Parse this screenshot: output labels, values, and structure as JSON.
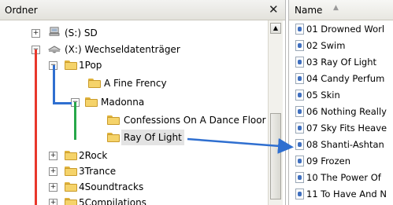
{
  "left_pane": {
    "title": "Ordner",
    "close_glyph": "✕"
  },
  "tree": {
    "items": [
      {
        "label": "(S:) SD",
        "icon": "network-drive-icon",
        "expander": "+"
      },
      {
        "label": "(X:) Wechseldatenträger",
        "icon": "removable-drive-icon",
        "expander": "−"
      },
      {
        "label": "1Pop",
        "icon": "folder-icon",
        "expander": "−"
      },
      {
        "label": "A Fine Frency",
        "icon": "folder-icon"
      },
      {
        "label": "Madonna",
        "icon": "folder-icon",
        "expander": "−"
      },
      {
        "label": "Confessions On A Dance Floor",
        "icon": "folder-icon"
      },
      {
        "label": "Ray Of Light",
        "icon": "folder-icon",
        "selected": true
      },
      {
        "label": "2Rock",
        "icon": "folder-icon",
        "expander": "+"
      },
      {
        "label": "3Trance",
        "icon": "folder-icon",
        "expander": "+"
      },
      {
        "label": "4Soundtracks",
        "icon": "folder-icon",
        "expander": "+"
      },
      {
        "label": "5Compilations",
        "icon": "folder-icon",
        "expander": "+"
      }
    ]
  },
  "right_pane": {
    "column_header": "Name",
    "files": [
      "01 Drowned Worl",
      "02 Swim",
      "03 Ray Of Light",
      "04 Candy Perfum",
      "05 Skin",
      "06 Nothing Really",
      "07 Sky Fits Heave",
      "08 Shanti-Ashtan",
      "09 Frozen",
      "10 The Power Of",
      "11 To Have And N"
    ]
  },
  "colors": {
    "red_line": "#e8372b",
    "blue_line": "#2f6fd0",
    "green_line": "#27a84a",
    "arrow": "#2f6fd0",
    "folder": "#f5d36a"
  }
}
